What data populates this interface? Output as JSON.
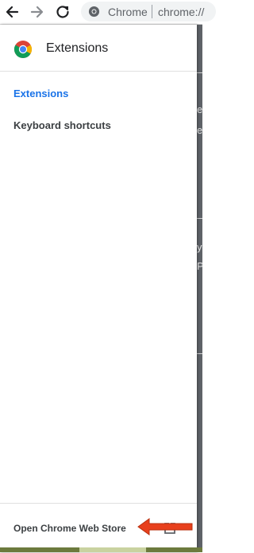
{
  "browser": {
    "chip_label": "Chrome",
    "url_text": "chrome://"
  },
  "drawer": {
    "title": "Extensions",
    "items": [
      {
        "label": "Extensions",
        "active": true
      },
      {
        "label": "Keyboard shortcuts",
        "active": false
      }
    ],
    "footer_link": "Open Chrome Web Store"
  },
  "background_fragments": [
    "e",
    "e",
    "y",
    "P"
  ],
  "icons": [
    "back-arrow-icon",
    "forward-arrow-icon",
    "reload-icon",
    "chrome-site-icon",
    "chrome-logo-icon",
    "external-link-icon",
    "red-arrow-annotation"
  ],
  "colors": {
    "active_link": "#1a73e8",
    "text": "#3c4043",
    "arrow": "#e8401c"
  }
}
